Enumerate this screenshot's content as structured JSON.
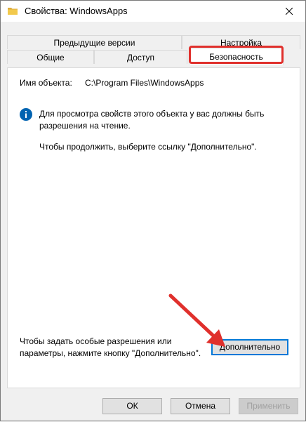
{
  "window": {
    "title": "Свойства: WindowsApps",
    "title_icon": "folder-icon",
    "close_icon": "close-icon"
  },
  "tabs_back": [
    {
      "label": "Предыдущие версии"
    },
    {
      "label": "Настройка"
    }
  ],
  "tabs_front": [
    {
      "label": "Общие"
    },
    {
      "label": "Доступ"
    },
    {
      "label": "Безопасность"
    }
  ],
  "security": {
    "object_label": "Имя объекта:",
    "object_value": "C:\\Program Files\\WindowsApps",
    "info_text": "Для просмотра свойств этого объекта у вас должны быть разрешения на чтение.",
    "continue_text": "Чтобы продолжить, выберите ссылку \"Дополнительно\".",
    "advanced_hint": "Чтобы задать особые разрешения или параметры, нажмите кнопку \"Дополнительно\".",
    "advanced_button": "Дополнительно"
  },
  "buttons": {
    "ok": "ОК",
    "cancel": "Отмена",
    "apply": "Применить"
  },
  "colors": {
    "highlight": "#e0302c",
    "info_icon": "#0063b1",
    "folder": "#f2c94c"
  }
}
